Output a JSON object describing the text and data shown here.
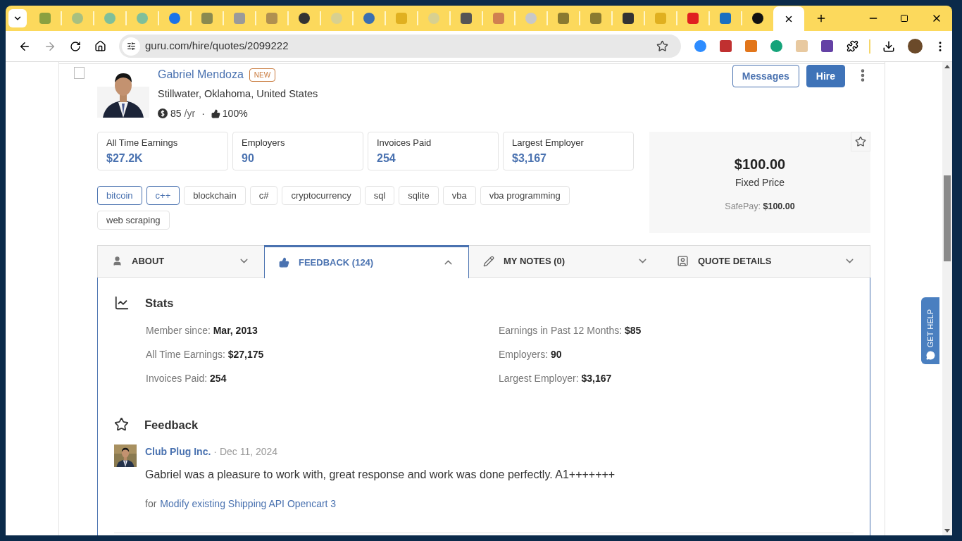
{
  "browser": {
    "tabs": [
      {
        "kind": "square",
        "color": "#8aa040",
        "selected": false
      },
      {
        "kind": "circle",
        "color": "#a8c080",
        "selected": false
      },
      {
        "kind": "circle",
        "color": "#7fbf9a",
        "selected": false
      },
      {
        "kind": "circle",
        "color": "#7fbf9a",
        "selected": false
      },
      {
        "kind": "circle",
        "color": "#1a73e8",
        "selected": false
      },
      {
        "kind": "square",
        "color": "#8a8a50",
        "selected": false
      },
      {
        "kind": "square",
        "color": "#9a9a9a",
        "selected": false
      },
      {
        "kind": "square",
        "color": "#b09050",
        "selected": false
      },
      {
        "kind": "circle",
        "color": "#333333",
        "selected": false
      },
      {
        "kind": "circle",
        "color": "#d8d090",
        "selected": false
      },
      {
        "kind": "circle",
        "color": "#3a6fb0",
        "selected": false
      },
      {
        "kind": "square",
        "color": "#e0b020",
        "selected": false
      },
      {
        "kind": "circle",
        "color": "#d8d090",
        "selected": false
      },
      {
        "kind": "square",
        "color": "#555555",
        "selected": false
      },
      {
        "kind": "square",
        "color": "#d08050",
        "selected": false
      },
      {
        "kind": "circle",
        "color": "#c8c8c8",
        "selected": false
      },
      {
        "kind": "square",
        "color": "#8a7a30",
        "selected": false
      },
      {
        "kind": "square",
        "color": "#8a7a30",
        "selected": false
      },
      {
        "kind": "square",
        "color": "#333333",
        "selected": false
      },
      {
        "kind": "square",
        "color": "#e0b020",
        "selected": false
      },
      {
        "kind": "square",
        "color": "#e02020",
        "selected": false
      },
      {
        "kind": "square",
        "color": "#1a6fc0",
        "selected": false
      },
      {
        "kind": "circle",
        "color": "#111111",
        "selected": false
      },
      {
        "kind": "blank",
        "selected": true
      }
    ],
    "url": "guru.com/hire/quotes/2099222",
    "extensions": [
      {
        "kind": "circle",
        "color": "#2d8cff"
      },
      {
        "kind": "square",
        "color": "#c03030"
      },
      {
        "kind": "square",
        "color": "#e2761b"
      },
      {
        "kind": "circle",
        "color": "#15a37a"
      },
      {
        "kind": "square",
        "color": "#e8c9a0"
      },
      {
        "kind": "square",
        "color": "#6441a5"
      }
    ]
  },
  "profile": {
    "checked": false,
    "name": "Gabriel Mendoza",
    "badge": "NEW",
    "location": "Stillwater, Oklahoma, United States",
    "rate": "85",
    "rate_unit": "/yr",
    "separator": "·",
    "rating": "100%"
  },
  "actions": [
    {
      "kind": "outline",
      "label": "Messages"
    },
    {
      "kind": "primary",
      "label": "Hire"
    }
  ],
  "summary": [
    {
      "label": "All Time Earnings",
      "value": "$27.2K"
    },
    {
      "label": "Employers",
      "value": "90"
    },
    {
      "label": "Invoices Paid",
      "value": "254"
    },
    {
      "label": "Largest Employer",
      "value": "$3,167"
    }
  ],
  "price": {
    "amount": "$100.00",
    "type": "Fixed Price",
    "safepay_label": "SafePay:",
    "safepay_value": "$100.00"
  },
  "skills": [
    {
      "label": "bitcoin",
      "highlighted": true
    },
    {
      "label": "c++",
      "highlighted": true
    },
    {
      "label": "blockchain",
      "highlighted": false
    },
    {
      "label": "c#",
      "highlighted": false
    },
    {
      "label": "cryptocurrency",
      "highlighted": false
    },
    {
      "label": "sql",
      "highlighted": false
    },
    {
      "label": "sqlite",
      "highlighted": false
    },
    {
      "label": "vba",
      "highlighted": false
    },
    {
      "label": "vba programming",
      "highlighted": false
    },
    {
      "label": "web scraping",
      "highlighted": false
    }
  ],
  "sections": [
    {
      "kind": "about",
      "label": "ABOUT",
      "expanded": false
    },
    {
      "kind": "feedback",
      "label": "FEEDBACK (124)",
      "expanded": true
    },
    {
      "kind": "notes",
      "label": "MY NOTES (0)",
      "expanded": false
    },
    {
      "kind": "quote",
      "label": "QUOTE DETAILS",
      "expanded": false
    }
  ],
  "stats": {
    "title": "Stats",
    "left": [
      {
        "label": "Member since:",
        "value": "Mar, 2013"
      },
      {
        "label": "All Time Earnings:",
        "value": "$27,175"
      },
      {
        "label": "Invoices Paid:",
        "value": "254"
      }
    ],
    "right": [
      {
        "label": "Earnings in Past 12 Months:",
        "value": "$85"
      },
      {
        "label": "Employers:",
        "value": "90"
      },
      {
        "label": "Largest Employer:",
        "value": "$3,167"
      }
    ]
  },
  "feedback": {
    "title": "Feedback",
    "entries": [
      {
        "author": "Club Plug Inc.",
        "date": "· Dec 11, 2024",
        "text": "Gabriel was a pleasure to work with, great response and work was done perfectly. A1+++++++",
        "for_label": "for",
        "project": "Modify existing Shipping API Opencart 3"
      }
    ]
  },
  "help_tab": "GET HELP"
}
